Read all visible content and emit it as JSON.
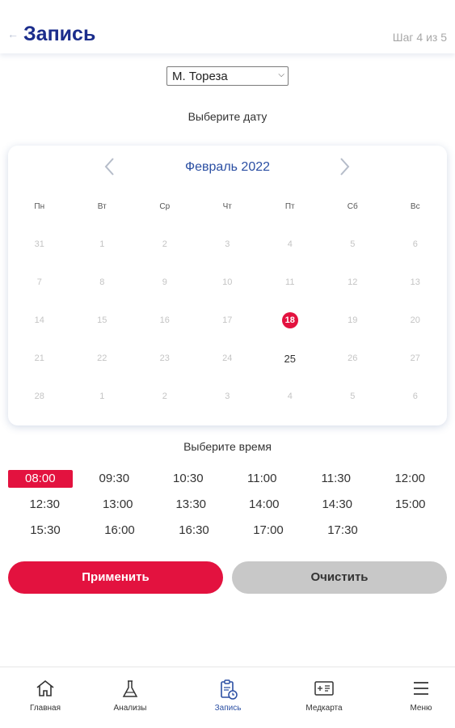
{
  "header": {
    "back_icon": "back-arrow-icon",
    "title": "Запись",
    "step": "Шаг 4 из 5"
  },
  "clinic_select": {
    "value": "М. Тореза"
  },
  "date_label": "Выберите дату",
  "calendar": {
    "month": "Февраль 2022",
    "weekdays": [
      "Пн",
      "Вт",
      "Ср",
      "Чт",
      "Пт",
      "Сб",
      "Вс"
    ],
    "weeks": [
      [
        "31",
        "1",
        "2",
        "3",
        "4",
        "5",
        "6"
      ],
      [
        "7",
        "8",
        "9",
        "10",
        "11",
        "12",
        "13"
      ],
      [
        "14",
        "15",
        "16",
        "17",
        "18",
        "19",
        "20"
      ],
      [
        "21",
        "22",
        "23",
        "24",
        "25",
        "26",
        "27"
      ],
      [
        "28",
        "1",
        "2",
        "3",
        "4",
        "5",
        "6"
      ]
    ],
    "selected_day": "18",
    "available_day": "25",
    "accent_color": "#e3123f",
    "title_color": "#2b4fa3"
  },
  "time_label": "Выберите время",
  "times": [
    [
      "08:00",
      "09:30",
      "10:30",
      "11:00",
      "11:30",
      "12:00"
    ],
    [
      "12:30",
      "13:00",
      "13:30",
      "14:00",
      "14:30",
      "15:00"
    ],
    [
      "15:30",
      "16:00",
      "16:30",
      "17:00",
      "17:30"
    ]
  ],
  "selected_time": "08:00",
  "buttons": {
    "apply": "Применить",
    "clear": "Очистить"
  },
  "tabbar": [
    {
      "label": "Главная",
      "icon": "home-icon"
    },
    {
      "label": "Анализы",
      "icon": "flask-icon"
    },
    {
      "label": "Запись",
      "icon": "clipboard-icon",
      "active": true
    },
    {
      "label": "Медкарта",
      "icon": "medcard-icon"
    },
    {
      "label": "Меню",
      "icon": "menu-icon"
    }
  ]
}
